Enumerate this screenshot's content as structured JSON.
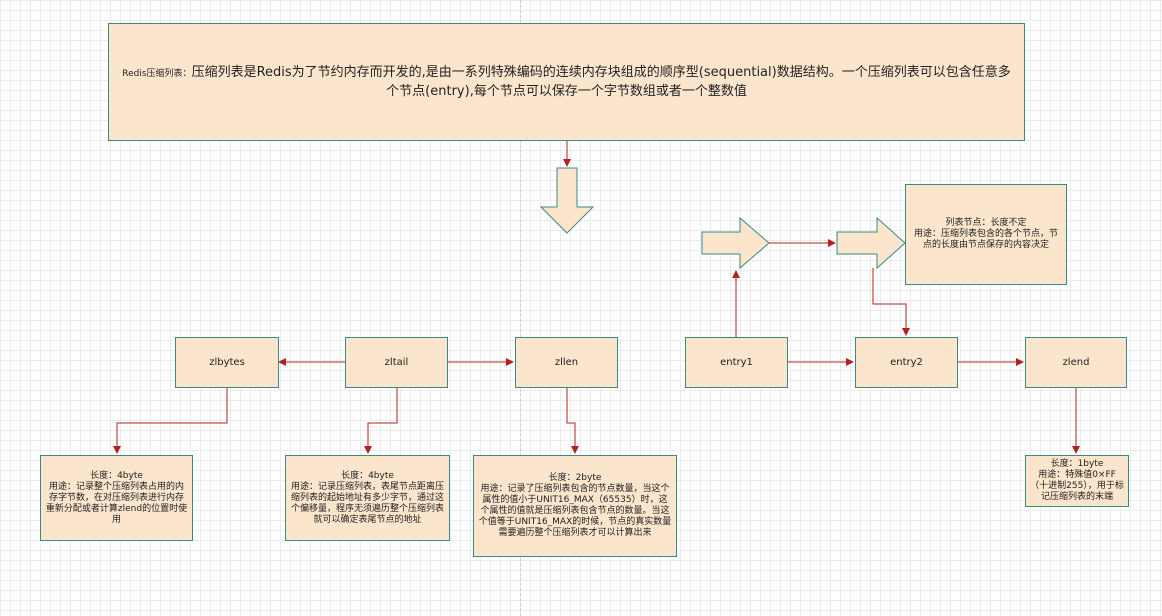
{
  "title": {
    "prefix": "Redis压缩列表：",
    "text": "压缩列表是Redis为了节约内存而开发的,是由一系列特殊编码的连续内存块组成的顺序型(sequential)数据结构。一个压缩列表可以包含任意多个节点(entry),每个节点可以保存一个字节数组或者一个整数值"
  },
  "nodes": {
    "zlbytes": "zlbytes",
    "zltail": "zltail",
    "zllen": "zllen",
    "entry1": "entry1",
    "entry2": "entry2",
    "zlend": "zlend"
  },
  "descriptions": {
    "zlbytes": "长度：4byte\n用途：记录整个压缩列表占用的内存字节数，在对压缩列表进行内存重新分配或者计算zlend的位置时使用",
    "zltail": "长度：4byte\n用途：记录压缩列表，表尾节点距离压缩列表的起始地址有多少字节，通过这个偏移量，程序无须遍历整个压缩列表就可以确定表尾节点的地址",
    "zllen": "长度：2byte\n用途：记录了压缩列表包含的节点数量，当这个属性的值小于UNIT16_MAX（65535）时，这个属性的值就是压缩列表包含节点的数量。当这个值等于UNIT16_MAX的时候，节点的真实数量需要遍历整个压缩列表才可以计算出来",
    "entry": "列表节点：长度不定\n用途：压缩列表包含的各个节点，节点的长度由节点保存的内容决定",
    "zlend": "长度：1byte\n用途：特殊值0×FF（十进制255），用于标记压缩列表的末端"
  },
  "colors": {
    "box_fill": "#fbe5cc",
    "box_border": "#3a8a82",
    "connector": "#b22222"
  }
}
